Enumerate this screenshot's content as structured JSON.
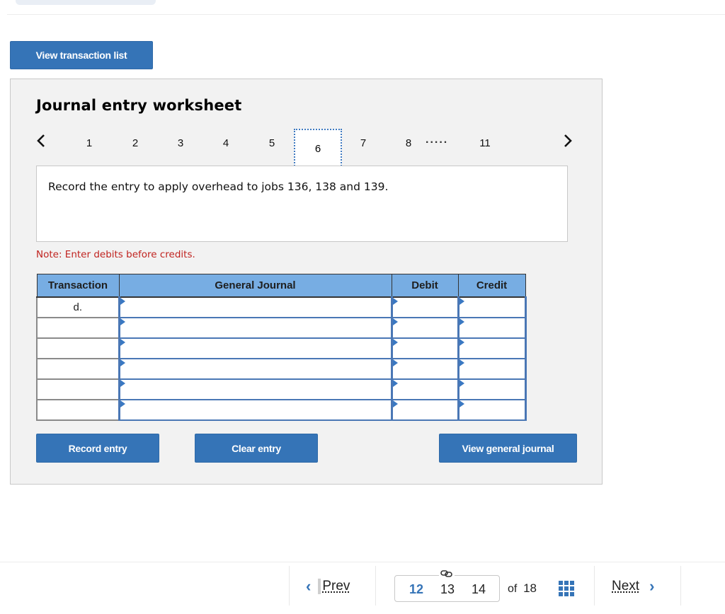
{
  "toolbar": {
    "view_transaction_list": "View transaction list"
  },
  "worksheet": {
    "title": "Journal entry worksheet",
    "pager": {
      "items": [
        "1",
        "2",
        "3",
        "4",
        "5",
        "6",
        "7",
        "8",
        "11"
      ],
      "active": "6",
      "ellipsis": ".....",
      "prev_icon": "chevron-left-icon",
      "next_icon": "chevron-right-icon"
    },
    "prompt": "Record the entry to apply overhead to jobs 136, 138 and 139.",
    "note": "Note: Enter debits before credits.",
    "table": {
      "headers": [
        "Transaction",
        "General Journal",
        "Debit",
        "Credit"
      ],
      "rows": [
        {
          "transaction": "d.",
          "account": "",
          "debit": "",
          "credit": ""
        },
        {
          "transaction": "",
          "account": "",
          "debit": "",
          "credit": ""
        },
        {
          "transaction": "",
          "account": "",
          "debit": "",
          "credit": ""
        },
        {
          "transaction": "",
          "account": "",
          "debit": "",
          "credit": ""
        },
        {
          "transaction": "",
          "account": "",
          "debit": "",
          "credit": ""
        },
        {
          "transaction": "",
          "account": "",
          "debit": "",
          "credit": ""
        }
      ]
    },
    "buttons": {
      "record": "Record entry",
      "clear": "Clear entry",
      "view_general_journal": "View general journal"
    }
  },
  "footer": {
    "prev": "Prev",
    "next": "Next",
    "pages": [
      "12",
      "13",
      "14"
    ],
    "current_page": "12",
    "of_label": "of",
    "total_pages": "18",
    "colors": {
      "accent": "#3574b7"
    }
  }
}
